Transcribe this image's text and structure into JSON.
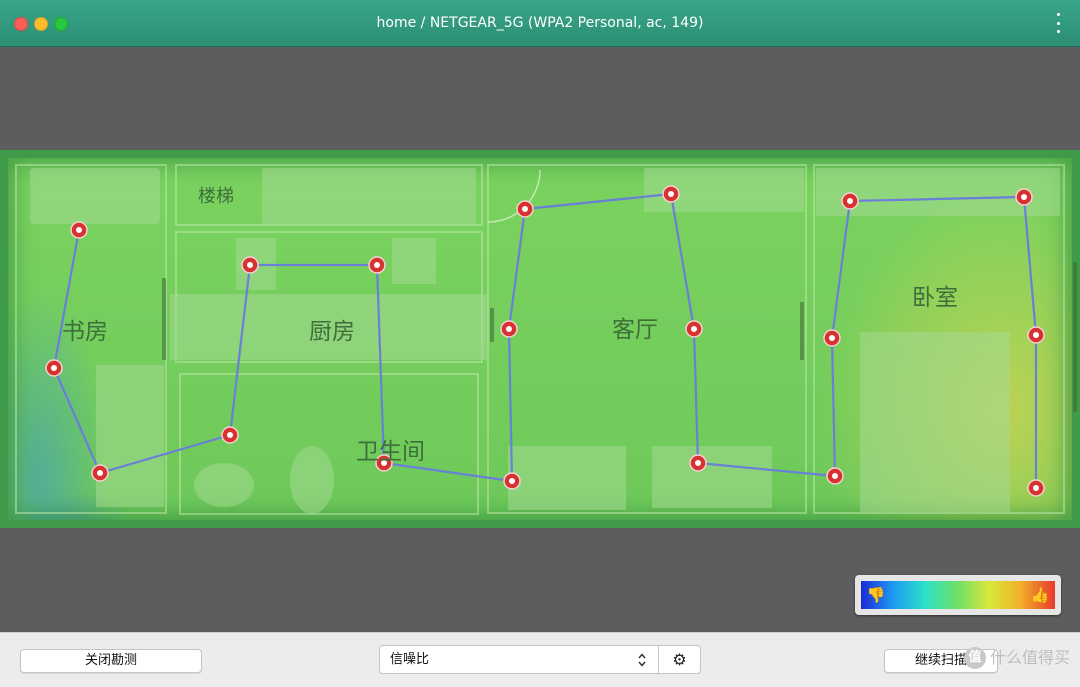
{
  "window": {
    "title": "home / NETGEAR_5G (WPA2 Personal, ac, 149)",
    "menu_icon": "more-vertical-icon"
  },
  "floorplan": {
    "rooms": [
      {
        "id": "study",
        "label": "书房"
      },
      {
        "id": "stairs",
        "label": "楼梯"
      },
      {
        "id": "kitchen",
        "label": "厨房"
      },
      {
        "id": "living",
        "label": "客厅"
      },
      {
        "id": "bedroom",
        "label": "卧室"
      },
      {
        "id": "bathroom",
        "label": "卫生间"
      }
    ],
    "colors": {
      "path": "#6a7fd8",
      "point_fill": "#d7322f",
      "point_center": "#ffffff"
    }
  },
  "legend": {
    "low_icon": "thumbs-down-icon",
    "high_icon": "thumbs-up-icon",
    "low_glyph": "👎",
    "high_glyph": "👍"
  },
  "footer": {
    "close_survey_label": "关闭勘测",
    "metric_select_value": "信噪比",
    "settings_icon": "gear-icon",
    "settings_glyph": "⚙",
    "continue_scan_label": "继续扫描",
    "watermark_logo": "值",
    "watermark_text": "什么值得买"
  }
}
